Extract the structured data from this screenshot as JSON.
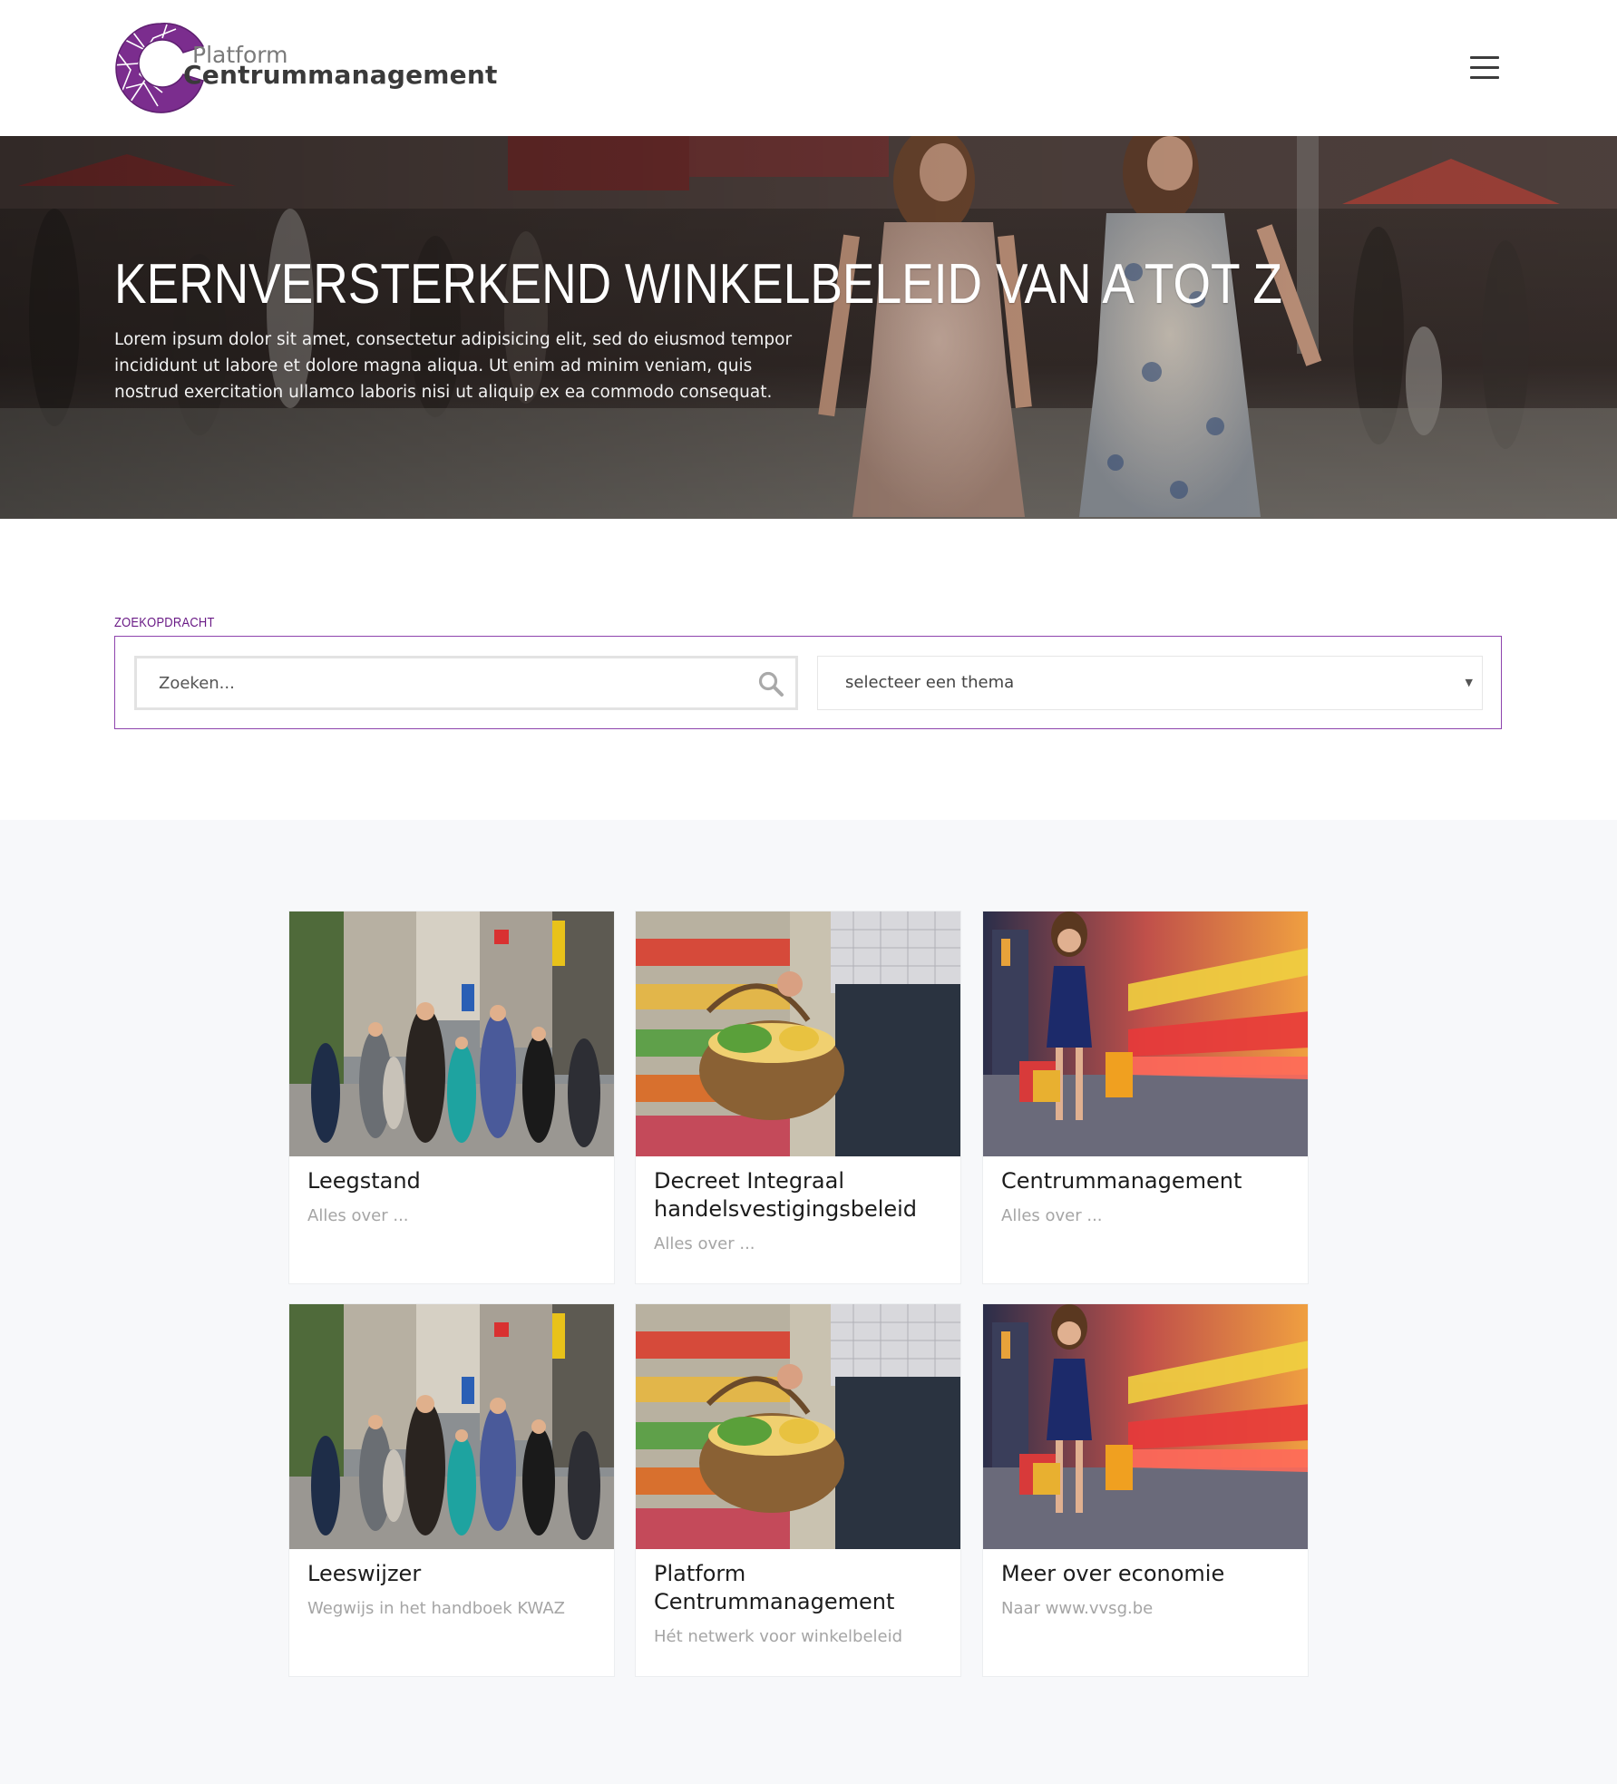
{
  "header": {
    "logo_small": "Platform",
    "logo_big": "Centrummanagement",
    "menu_icon": "hamburger-menu-icon"
  },
  "hero": {
    "title": "KERNVERSTERKEND WINKELBELEID VAN A TOT Z",
    "text": "Lorem ipsum dolor sit amet, consectetur adipisicing elit, sed do eiusmod tempor incididunt ut labore et dolore magna aliqua. Ut enim ad minim veniam, quis nostrud exercitation ullamco laboris nisi ut aliquip ex ea commodo consequat."
  },
  "search": {
    "label": "ZOEKOPDRACHT",
    "placeholder": "Zoeken...",
    "theme_selected": "selecteer een thema",
    "search_icon": "search-icon",
    "caret_icon": "caret-down-icon"
  },
  "cards": [
    {
      "title": "Leegstand",
      "subtitle": "Alles over ...",
      "image": "shopping-street-photo"
    },
    {
      "title": "Decreet Integraal handelsvestigingsbeleid",
      "subtitle": "Alles over ...",
      "image": "grocery-basket-photo"
    },
    {
      "title": "Centrummanagement",
      "subtitle": "Alles over ...",
      "image": "woman-shopping-bags-photo"
    },
    {
      "title": "Leeswijzer",
      "subtitle": "Wegwijs in het handboek KWAZ",
      "image": "shopping-street-photo"
    },
    {
      "title": "Platform Centrummanagement",
      "subtitle": "Hét netwerk voor winkelbeleid",
      "image": "grocery-basket-photo"
    },
    {
      "title": "Meer over economie",
      "subtitle": "Naar www.vvsg.be",
      "image": "woman-shopping-bags-photo"
    }
  ],
  "colors": {
    "brand_purple": "#7b2d8e",
    "label_purple": "#6a1b86",
    "section_bg": "#f7f8fa"
  }
}
